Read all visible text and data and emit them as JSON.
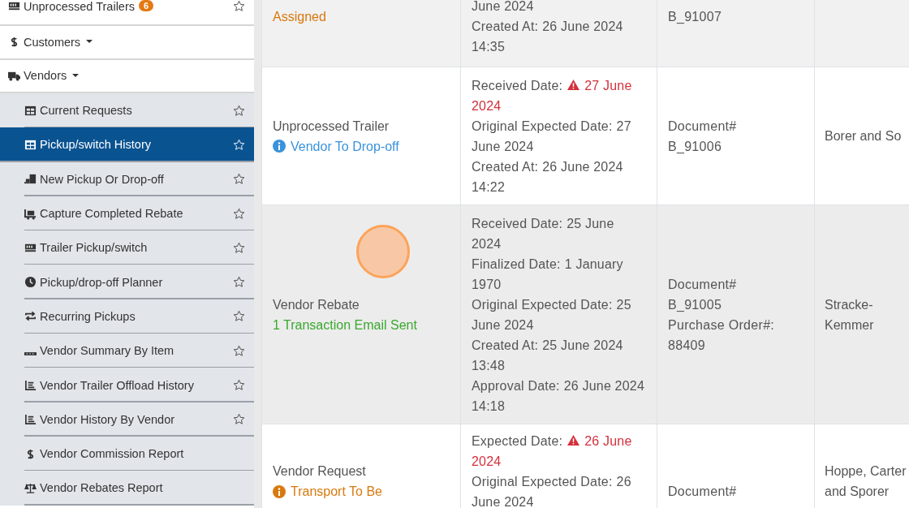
{
  "sidebar": {
    "items": [
      {
        "kind": "top",
        "label": "Unprocessed Trailers",
        "badge": "6",
        "star": true,
        "caret": false,
        "selected": false
      },
      {
        "kind": "top",
        "label": "Customers",
        "star": false,
        "caret": true,
        "selected": false
      },
      {
        "kind": "top",
        "label": "Vendors",
        "star": false,
        "caret": true,
        "selected": false
      },
      {
        "kind": "sub",
        "label": "Current Requests",
        "star": true,
        "selected": false
      },
      {
        "kind": "sub",
        "label": "Pickup/switch History",
        "star": true,
        "selected": true
      },
      {
        "kind": "sub",
        "label": "New Pickup Or Drop-off",
        "star": true,
        "selected": false
      },
      {
        "kind": "sub",
        "label": "Capture Completed Rebate",
        "star": true,
        "selected": false
      },
      {
        "kind": "sub",
        "label": "Trailer Pickup/switch",
        "star": true,
        "selected": false
      },
      {
        "kind": "sub",
        "label": "Pickup/drop-off Planner",
        "star": true,
        "selected": false
      },
      {
        "kind": "sub",
        "label": "Recurring Pickups",
        "star": true,
        "selected": false
      },
      {
        "kind": "sub",
        "label": "Vendor Summary By Item",
        "star": true,
        "selected": false
      },
      {
        "kind": "sub",
        "label": "Vendor Trailer Offload History",
        "star": true,
        "selected": false
      },
      {
        "kind": "sub",
        "label": "Vendor History By Vendor",
        "star": true,
        "selected": false
      },
      {
        "kind": "sub",
        "label": "Vendor Commission Report",
        "star": false,
        "selected": false
      },
      {
        "kind": "sub",
        "label": "Vendor Rebates Report",
        "star": false,
        "selected": false
      }
    ]
  },
  "table": {
    "rows": [
      {
        "status": {
          "text": "Assigned",
          "kind": "warning",
          "icon": false
        },
        "dates": [
          {
            "value": "June 2024",
            "warning": false
          },
          {
            "label": "Created At:",
            "value": "26 June 2024 14:35",
            "warning": false
          }
        ],
        "documents": [
          "B_91007"
        ]
      },
      {
        "type": "Unprocessed Trailer",
        "status": {
          "text": "Vendor To Drop-off",
          "kind": "info",
          "icon": true
        },
        "dates": [
          {
            "label": "Received Date:",
            "value": "27 June 2024",
            "warning": true
          },
          {
            "label": "Original Expected Date:",
            "value": "27 June 2024",
            "warning": false
          },
          {
            "label": "Created At:",
            "value": "26 June 2024 14:22",
            "warning": false
          }
        ],
        "documents": [
          "Document#",
          "B_91006"
        ],
        "vendor": "Borer and So"
      },
      {
        "type": "Vendor Rebate",
        "status": {
          "text": "1 Transaction Email Sent",
          "kind": "success",
          "icon": false
        },
        "dates": [
          {
            "label": "Received Date:",
            "value": "25 June 2024",
            "warning": false
          },
          {
            "label": "Finalized Date:",
            "value": "1 January 1970",
            "warning": false
          },
          {
            "label": "Original Expected Date:",
            "value": "25 June 2024",
            "warning": false
          },
          {
            "label": "Created At:",
            "value": "25 June 2024 13:48",
            "warning": false
          },
          {
            "label": "Approval Date:",
            "value": "26 June 2024 14:18",
            "warning": false
          }
        ],
        "documents": [
          "Document#",
          "B_91005",
          "Purchase Order#:",
          "88409"
        ],
        "vendor": "Stracke-Kemmer"
      },
      {
        "type": "Vendor Request",
        "status": {
          "text": "Transport To Be",
          "kind": "warning",
          "icon": true
        },
        "dates": [
          {
            "label": "Expected Date:",
            "value": "26 June 2024",
            "warning": true
          },
          {
            "label": "Original Expected Date:",
            "value": "26 June 2024",
            "warning": false
          }
        ],
        "documents": [
          "Document#"
        ],
        "vendor": "Hoppe, Carter and Sporer"
      }
    ]
  }
}
